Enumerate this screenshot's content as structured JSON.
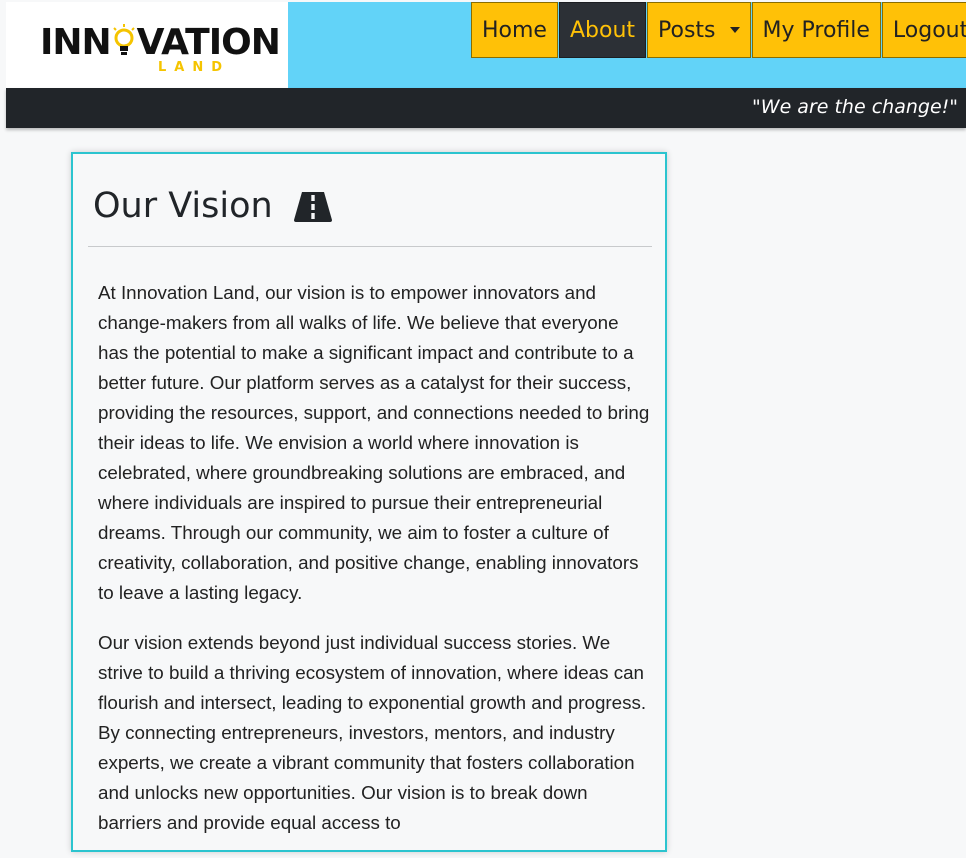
{
  "brand": {
    "logo_main_left": "INN",
    "logo_main_right": "VATION",
    "logo_sub": "LAND"
  },
  "nav": {
    "items": [
      {
        "label": "Home"
      },
      {
        "label": "About"
      },
      {
        "label": "Posts"
      },
      {
        "label": "My Profile"
      },
      {
        "label": "Logout"
      }
    ],
    "active": "About"
  },
  "slogan": "\"We are the change!\"",
  "vision": {
    "title": "Our Vision",
    "title_icon": "road-icon",
    "paragraphs": [
      "At Innovation Land, our vision is to empower innovators and change-makers from all walks of life. We believe that everyone has the potential to make a significant impact and contribute to a better future. Our platform serves as a catalyst for their success, providing the resources, support, and connections needed to bring their ideas to life. We envision a world where innovation is celebrated, where groundbreaking solutions are embraced, and where individuals are inspired to pursue their entrepreneurial dreams. Through our community, we aim to foster a culture of creativity, collaboration, and positive change, enabling innovators to leave a lasting legacy.",
      "Our vision extends beyond just individual success stories. We strive to build a thriving ecosystem of innovation, where ideas can flourish and intersect, leading to exponential growth and progress. By connecting entrepreneurs, investors, mentors, and industry experts, we create a vibrant community that fosters collaboration and unlocks new opportunities. Our vision is to break down barriers and provide equal access to"
    ]
  },
  "colors": {
    "header_bg": "#62d3f8",
    "nav_bg": "#ffc107",
    "nav_active_bg": "#2c3036",
    "slogan_bg": "#212529",
    "card_border": "#2bc4cf"
  }
}
